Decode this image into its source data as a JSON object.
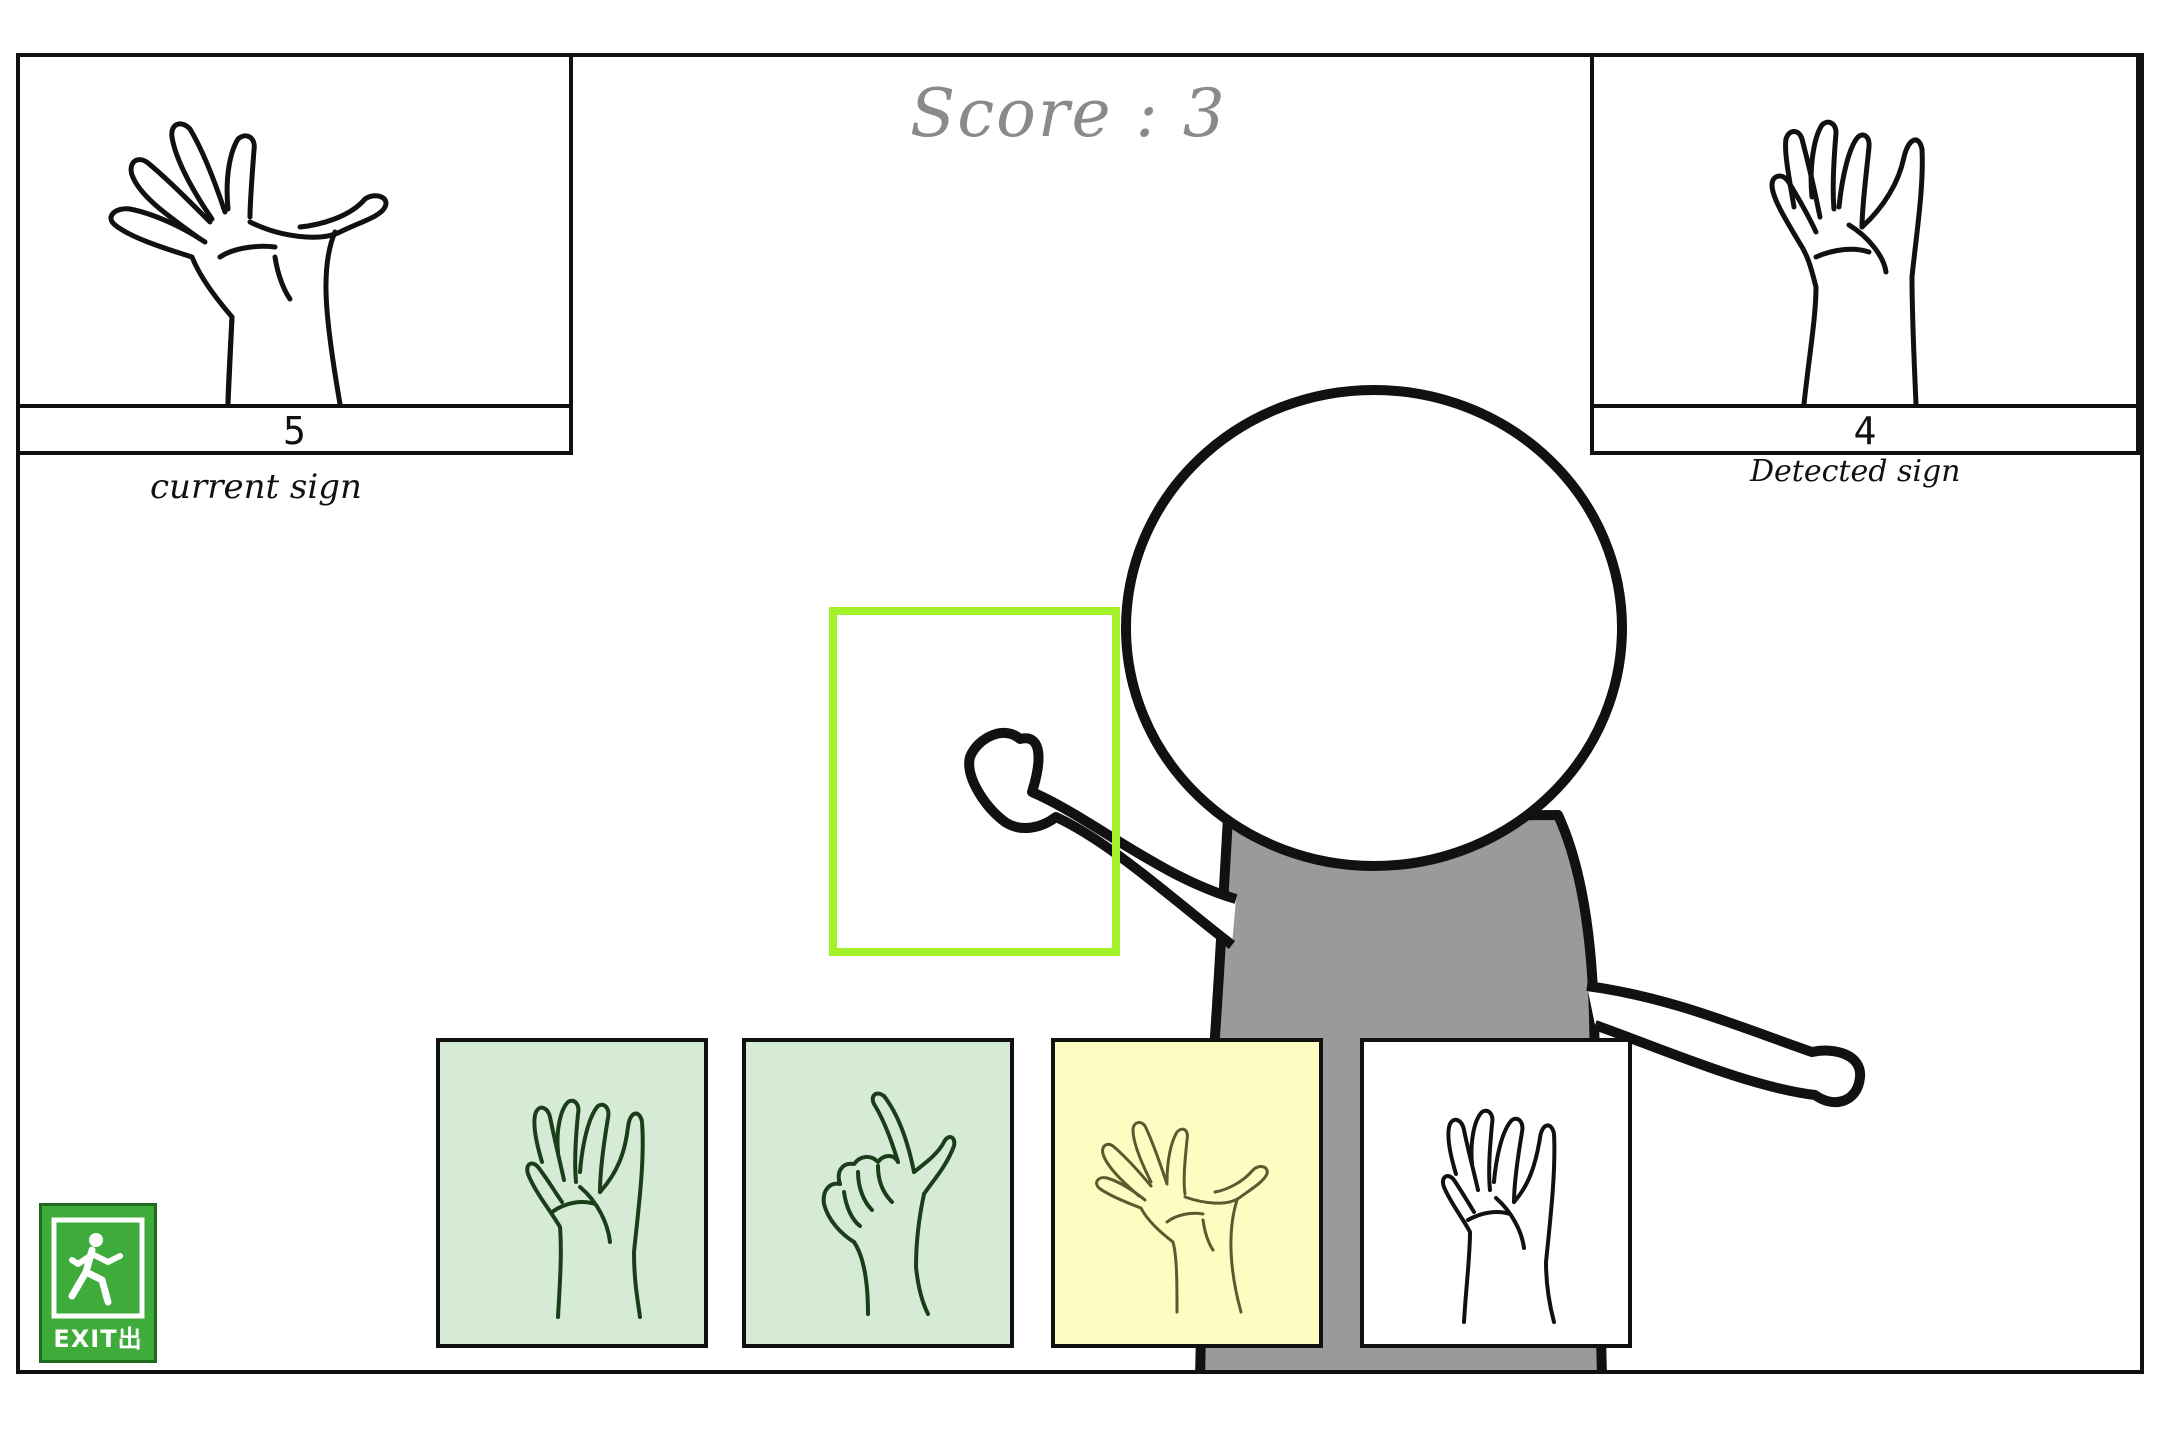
{
  "score": {
    "text": "Score : 3"
  },
  "current_sign": {
    "value": "5",
    "caption": "current sign"
  },
  "detected_sign": {
    "value": "4",
    "caption": "Detected sign"
  },
  "exit": {
    "label": "EXIT出",
    "color": "#3fab3a"
  },
  "target_box": {
    "color": "#a2f12a"
  },
  "choices": [
    {
      "name": "four",
      "state": "correct",
      "color": "#d5ebd5"
    },
    {
      "name": "pointing",
      "state": "correct",
      "color": "#d5ebd5"
    },
    {
      "name": "five",
      "state": "selected",
      "color": "#fdfdc2"
    },
    {
      "name": "four",
      "state": "plain",
      "color": "#ffffff"
    }
  ]
}
